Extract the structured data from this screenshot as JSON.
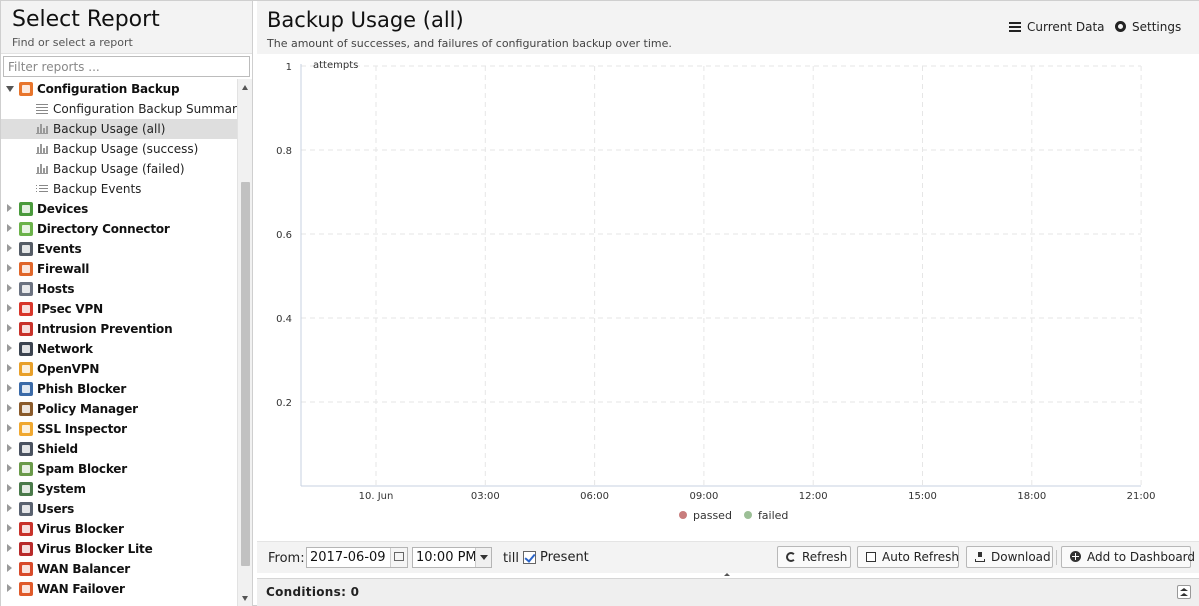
{
  "left": {
    "title": "Select Report",
    "subtitle": "Find or select a report",
    "filter_placeholder": "Filter reports ..."
  },
  "tree": {
    "expanded": {
      "label": "Configuration Backup",
      "icon": "configuration-backup-icon",
      "color": "#e8752c",
      "children": [
        {
          "label": "Configuration Backup Summary",
          "icon": "text-lines-icon",
          "selected": false
        },
        {
          "label": "Backup Usage (all)",
          "icon": "bar-chart-icon",
          "selected": true
        },
        {
          "label": "Backup Usage (success)",
          "icon": "bar-chart-icon",
          "selected": false
        },
        {
          "label": "Backup Usage (failed)",
          "icon": "bar-chart-icon",
          "selected": false
        },
        {
          "label": "Backup Events",
          "icon": "list-icon",
          "selected": false
        }
      ]
    },
    "categories": [
      {
        "label": "Devices",
        "icon": "devices-icon",
        "color": "#4a9a3c"
      },
      {
        "label": "Directory Connector",
        "icon": "directory-connector-icon",
        "color": "#6bb24a"
      },
      {
        "label": "Events",
        "icon": "events-icon",
        "color": "#555c66"
      },
      {
        "label": "Firewall",
        "icon": "firewall-icon",
        "color": "#e0662a"
      },
      {
        "label": "Hosts",
        "icon": "hosts-icon",
        "color": "#6b7280"
      },
      {
        "label": "IPsec VPN",
        "icon": "ipsec-vpn-icon",
        "color": "#d8362a"
      },
      {
        "label": "Intrusion Prevention",
        "icon": "intrusion-prevention-icon",
        "color": "#c8322a"
      },
      {
        "label": "Network",
        "icon": "network-icon",
        "color": "#3c4450"
      },
      {
        "label": "OpenVPN",
        "icon": "openvpn-icon",
        "color": "#e8a02a"
      },
      {
        "label": "Phish Blocker",
        "icon": "phish-blocker-icon",
        "color": "#3a6aa8"
      },
      {
        "label": "Policy Manager",
        "icon": "policy-manager-icon",
        "color": "#8a5a2a"
      },
      {
        "label": "SSL Inspector",
        "icon": "ssl-inspector-icon",
        "color": "#f0a830"
      },
      {
        "label": "Shield",
        "icon": "shield-icon",
        "color": "#4a5260"
      },
      {
        "label": "Spam Blocker",
        "icon": "spam-blocker-icon",
        "color": "#6a9a4a"
      },
      {
        "label": "System",
        "icon": "system-icon",
        "color": "#4a7a4a"
      },
      {
        "label": "Users",
        "icon": "users-icon",
        "color": "#5a6270"
      },
      {
        "label": "Virus Blocker",
        "icon": "virus-blocker-icon",
        "color": "#c8322a"
      },
      {
        "label": "Virus Blocker Lite",
        "icon": "virus-blocker-lite-icon",
        "color": "#b82a2a"
      },
      {
        "label": "WAN Balancer",
        "icon": "wan-balancer-icon",
        "color": "#d84a2a"
      },
      {
        "label": "WAN Failover",
        "icon": "wan-failover-icon",
        "color": "#e05a2a"
      }
    ]
  },
  "report": {
    "title": "Backup Usage (all)",
    "description": "The amount of successes, and failures of configuration backup over time.",
    "current_data_label": "Current Data",
    "settings_label": "Settings"
  },
  "chart_data": {
    "type": "line",
    "ylabel": "attempts",
    "ylim": [
      0,
      1
    ],
    "y_ticks": [
      "0.2",
      "0.4",
      "0.6",
      "0.8",
      "1"
    ],
    "x_ticks": [
      "10. Jun",
      "03:00",
      "06:00",
      "09:00",
      "12:00",
      "15:00",
      "18:00",
      "21:00"
    ],
    "series": [
      {
        "name": "passed",
        "color": "#c87c7c",
        "values": []
      },
      {
        "name": "failed",
        "color": "#9cbf96",
        "values": []
      }
    ],
    "grid": true,
    "legend": "bottom-center"
  },
  "toolbar": {
    "from_label": "From:",
    "date_value": "2017-06-09",
    "time_value": "10:00 PM",
    "till_label": "till",
    "present_label": "Present",
    "present_checked": true,
    "refresh_label": "Refresh",
    "auto_refresh_label": "Auto Refresh",
    "download_label": "Download",
    "add_dashboard_label": "Add to Dashboard"
  },
  "conditions": {
    "label": "Conditions: 0"
  }
}
